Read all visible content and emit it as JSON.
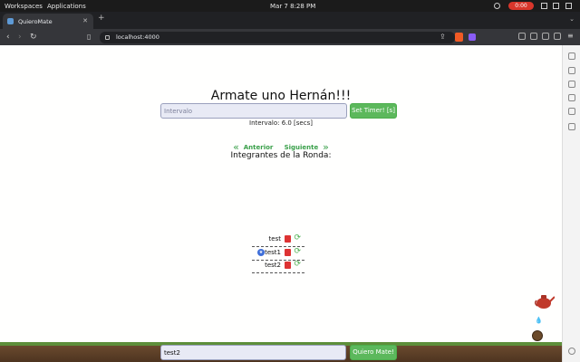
{
  "os": {
    "workspaces": "Workspaces",
    "applications": "Applications",
    "clock": "Mar 7  8:28 PM",
    "recording": "0:00"
  },
  "browser": {
    "tab_title": "QuieroMate",
    "url": "localhost:4000"
  },
  "app": {
    "title": "Armate uno Hernán!!!",
    "interval_placeholder": "Intervalo",
    "set_timer_label": "Set Timer! [s]",
    "interval_text": "Intervalo: 6.0 [secs]",
    "prev_label": "Anterior",
    "next_label": "Siguiente",
    "members_heading": "Integrantes de la Ronda:",
    "members": [
      {
        "name": "test",
        "active": false
      },
      {
        "name": "test1",
        "active": true
      },
      {
        "name": "test2",
        "active": false
      }
    ],
    "name_input_value": "test2",
    "submit_label": "Quiero Mate!"
  },
  "colors": {
    "accent_green": "#5cb85c",
    "link_green": "#3aa04a",
    "trash_red": "#dd3333"
  }
}
